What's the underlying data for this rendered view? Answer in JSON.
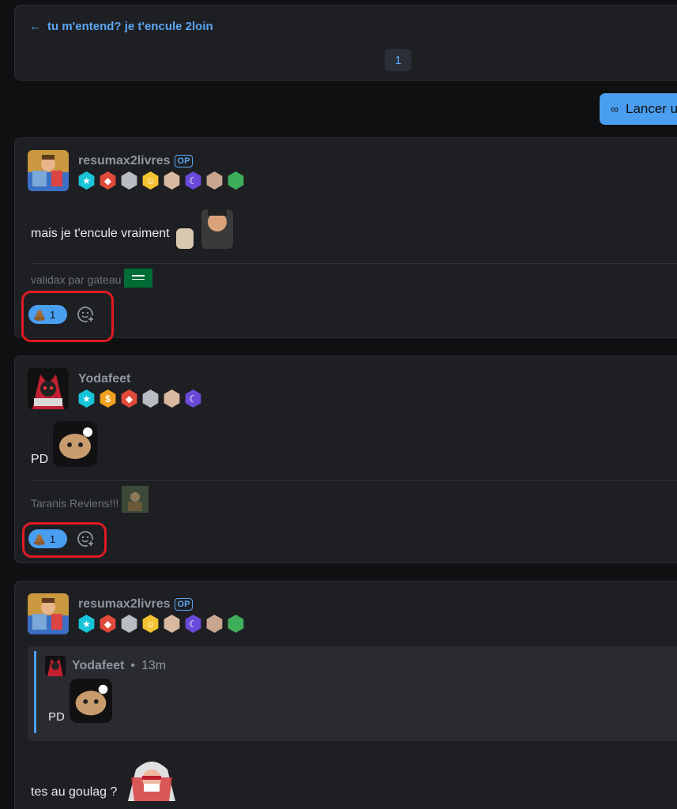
{
  "topic": {
    "back_icon": "arrow-left-icon",
    "title": "tu m'entend? je t'encule 2loin",
    "page_number": "1"
  },
  "launch_button": {
    "icon": "infinity-icon",
    "label": "Lancer u"
  },
  "colors": {
    "accent": "#4a9ef0",
    "highlight_border": "#e01b22",
    "card_bg": "#1e1f23",
    "page_bg": "#0f1012"
  },
  "posts": [
    {
      "username": "resumax2livres",
      "op_label": "OP",
      "message": "mais je t'encule vraiment",
      "signature": "validax par gateau",
      "reaction": {
        "emoji": "poop-icon",
        "count": "1"
      },
      "add_reaction_icon": "add-reaction-icon"
    },
    {
      "username": "Yodafeet",
      "message": "PD",
      "signature": "Taranis Reviens!!!",
      "reaction": {
        "emoji": "poop-icon",
        "count": "1"
      },
      "add_reaction_icon": "add-reaction-icon"
    },
    {
      "username": "resumax2livres",
      "op_label": "OP",
      "quote": {
        "author": "Yodafeet",
        "separator": "•",
        "time": "13m",
        "text": "PD"
      },
      "message": "tes au goulag ?"
    }
  ]
}
